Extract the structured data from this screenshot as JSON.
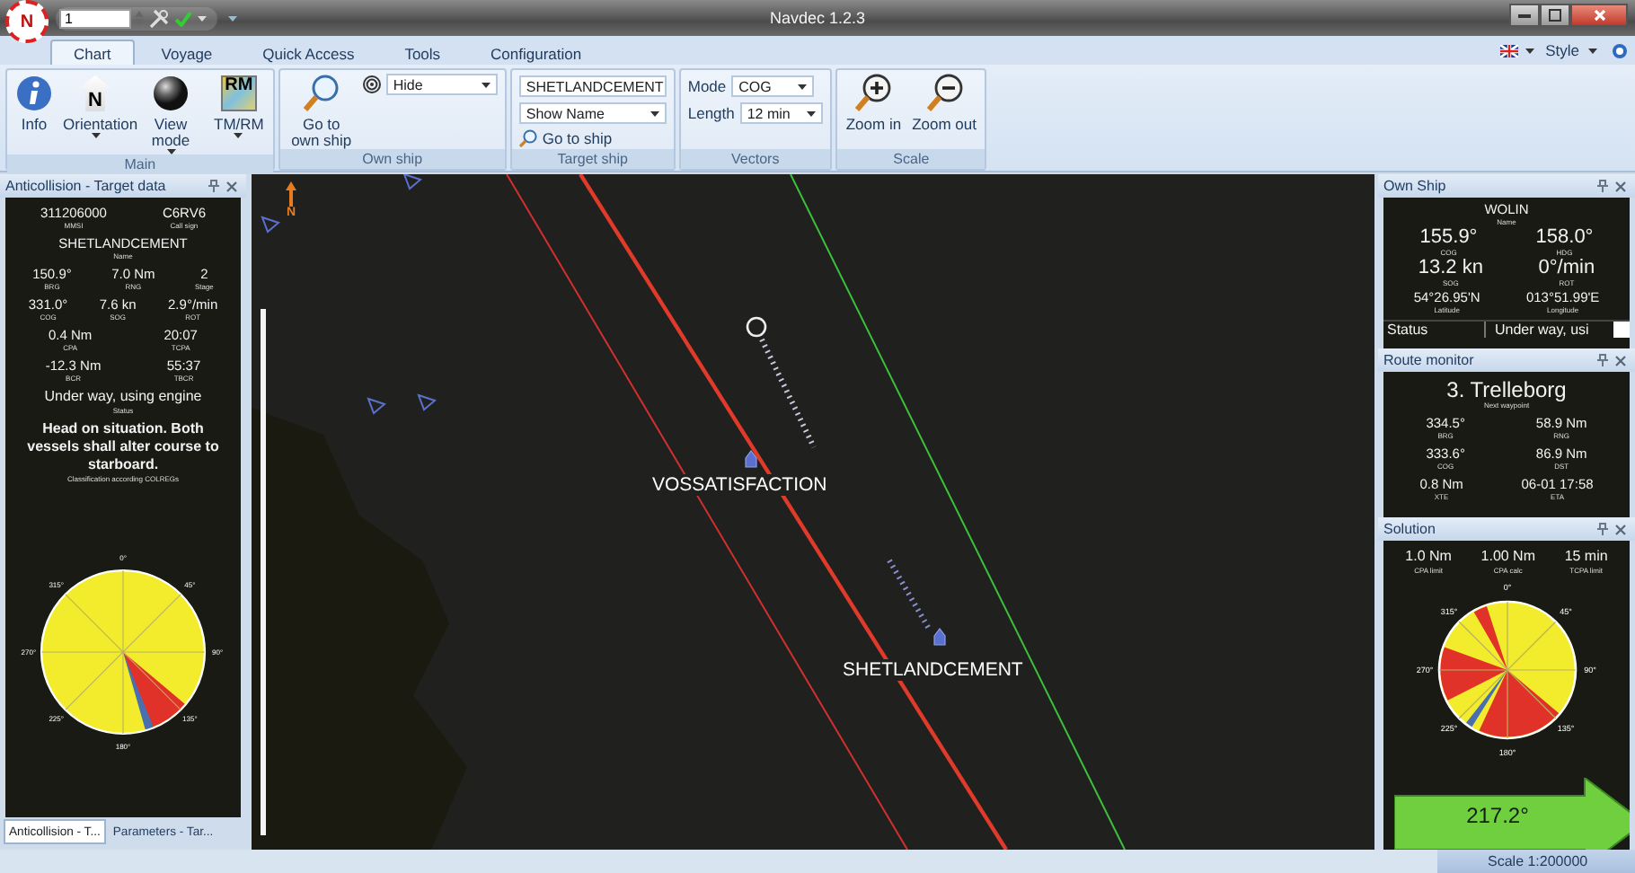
{
  "titlebar": {
    "logo_letter": "N",
    "quick_value": "1",
    "title": "Navdec 1.2.3"
  },
  "tabs": [
    {
      "label": "Chart",
      "selected": true
    },
    {
      "label": "Voyage",
      "selected": false
    },
    {
      "label": "Quick Access",
      "selected": false
    },
    {
      "label": "Tools",
      "selected": false
    },
    {
      "label": "Configuration",
      "selected": false
    }
  ],
  "style_menu": "Style",
  "ribbon": [
    {
      "title": "Main",
      "items": [
        {
          "kind": "large",
          "label": "Info",
          "menu": false
        },
        {
          "kind": "large",
          "label": "Orientation",
          "icon_text": "N",
          "menu": true
        },
        {
          "kind": "large",
          "label": "View mode",
          "menu": true
        },
        {
          "kind": "large",
          "label": "TM/RM",
          "icon_text": "RM",
          "menu": true
        }
      ]
    },
    {
      "title": "Own ship",
      "items": [
        {
          "kind": "large",
          "label": "Go to own ship",
          "menu": false
        },
        {
          "kind": "dropdown",
          "value": "Hide"
        }
      ]
    },
    {
      "title": "Target ship",
      "items": [
        {
          "kind": "dropdown",
          "value": "SHETLANDCEMENT"
        },
        {
          "kind": "dropdown",
          "value": "Show Name"
        },
        {
          "kind": "small",
          "label": "Go to ship"
        }
      ]
    },
    {
      "title": "Vectors",
      "items": [
        {
          "kind": "dropdown",
          "label": "Mode",
          "value": "COG"
        },
        {
          "kind": "dropdown",
          "label": "Length",
          "value": "12 min"
        }
      ]
    },
    {
      "title": "Scale",
      "items": [
        {
          "kind": "large",
          "label": "Zoom in",
          "menu": false
        },
        {
          "kind": "large",
          "label": "Zoom out",
          "menu": false
        }
      ]
    }
  ],
  "target_panel": {
    "title": "Anticollision - Target data",
    "rows": [
      [
        {
          "value": "311206000",
          "label": "MMSI"
        },
        {
          "value": "C6RV6",
          "label": "Call sign"
        }
      ],
      [
        {
          "value": "SHETLANDCEMENT",
          "label": "Name"
        }
      ],
      [
        {
          "value": "150.9°",
          "label": "BRG"
        },
        {
          "value": "7.0 Nm",
          "label": "RNG"
        },
        {
          "value": "2",
          "label": "Stage"
        }
      ],
      [
        {
          "value": "331.0°",
          "label": "COG"
        },
        {
          "value": "7.6 kn",
          "label": "SOG"
        },
        {
          "value": "2.9°/min",
          "label": "ROT"
        }
      ],
      [
        {
          "value": "0.4 Nm",
          "label": "CPA"
        },
        {
          "value": "20:07",
          "label": "TCPA"
        }
      ],
      [
        {
          "value": "-12.3 Nm",
          "label": "BCR"
        },
        {
          "value": "55:37",
          "label": "TBCR"
        }
      ],
      [
        {
          "value": "Under way, using engine",
          "label": "Status"
        }
      ],
      [
        {
          "value": "Head on situation. Both vessels shall alter course to starboard.",
          "label": "Classification according COLREGs"
        }
      ]
    ],
    "compass_labels": [
      "0°",
      "45°",
      "90°",
      "135°",
      "180°",
      "225°",
      "270°",
      "315°"
    ],
    "bottom_tabs": [
      {
        "label": "Anticollision - T...",
        "selected": true
      },
      {
        "label": "Parameters - Tar...",
        "selected": false
      }
    ]
  },
  "map": {
    "north_label": "N",
    "targets": [
      {
        "name": "VOSSATISFACTION"
      },
      {
        "name": "SHETLANDCEMENT"
      }
    ]
  },
  "own_ship": {
    "title": "Own Ship",
    "rows": [
      [
        {
          "value": "WOLIN",
          "label": "Name"
        }
      ],
      [
        {
          "value": "155.9°",
          "label": "COG"
        },
        {
          "value": "158.0°",
          "label": "HDG"
        }
      ],
      [
        {
          "value": "13.2 kn",
          "label": "SOG"
        },
        {
          "value": "0°/min",
          "label": "ROT"
        }
      ],
      [
        {
          "value": "54°26.95'N",
          "label": "Latitude"
        },
        {
          "value": "013°51.99'E",
          "label": "Longitude"
        }
      ]
    ],
    "status_label": "Status",
    "status_value": "Under way, usi"
  },
  "route_monitor": {
    "title": "Route monitor",
    "waypoint": "3. Trelleborg",
    "waypoint_label": "Next waypoint",
    "rows": [
      [
        {
          "value": "334.5°",
          "label": "BRG"
        },
        {
          "value": "58.9 Nm",
          "label": "RNG"
        }
      ],
      [
        {
          "value": "333.6°",
          "label": "COG"
        },
        {
          "value": "86.9 Nm",
          "label": "DST"
        }
      ],
      [
        {
          "value": "0.8 Nm",
          "label": "XTE"
        },
        {
          "value": "06-01 17:58",
          "label": "ETA"
        }
      ]
    ]
  },
  "solution": {
    "title": "Solution",
    "rows": [
      [
        {
          "value": "1.0 Nm",
          "label": "CPA limit"
        },
        {
          "value": "1.00 Nm",
          "label": "CPA calc"
        },
        {
          "value": "15 min",
          "label": "TCPA limit"
        }
      ]
    ],
    "compass_labels": [
      "0°",
      "45°",
      "90°",
      "135°",
      "180°",
      "225°",
      "270°",
      "315°"
    ],
    "course": "217.2°"
  },
  "status_bar": {
    "scale": "Scale 1:200000"
  }
}
